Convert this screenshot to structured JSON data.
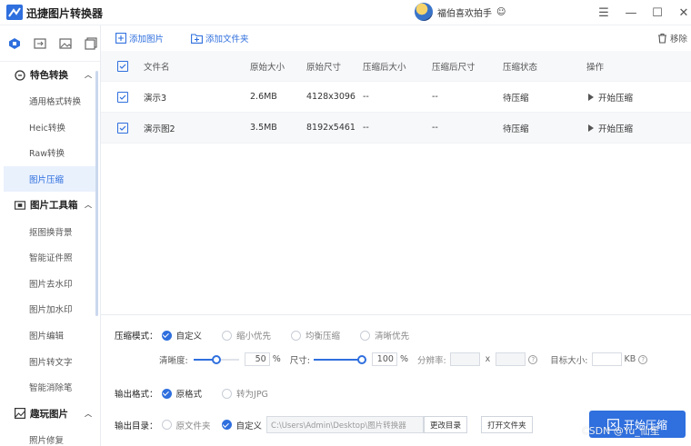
{
  "app": {
    "title": "迅捷图片转换器",
    "user_name": "福伯喜欢拍手"
  },
  "window": {
    "minimize": "—",
    "maximize": "☐",
    "close": "✕",
    "menu": "☰"
  },
  "sidebar": {
    "groups": [
      {
        "label": "特色转换",
        "items": [
          "通用格式转换",
          "Heic转换",
          "Raw转换",
          "图片压缩"
        ]
      },
      {
        "label": "图片工具箱",
        "items": [
          "抠图换背景",
          "智能证件照",
          "图片去水印",
          "图片加水印",
          "图片编辑",
          "图片转文字",
          "智能消除笔"
        ]
      },
      {
        "label": "趣玩图片",
        "items": [
          "照片修复"
        ]
      }
    ],
    "active_item": "图片压缩"
  },
  "toolbar": {
    "add_image": "添加图片",
    "add_folder": "添加文件夹",
    "remove": "移除"
  },
  "table": {
    "headers": [
      "文件名",
      "原始大小",
      "原始尺寸",
      "压缩后大小",
      "压缩后尺寸",
      "压缩状态",
      "操作"
    ],
    "rows": [
      {
        "name": "演示3",
        "size": "2.6MB",
        "dims": "4128x3096",
        "after_size": "--",
        "after_dims": "--",
        "status": "待压缩",
        "action": "开始压缩"
      },
      {
        "name": "演示图2",
        "size": "3.5MB",
        "dims": "8192x5461",
        "after_size": "--",
        "after_dims": "--",
        "status": "待压缩",
        "action": "开始压缩"
      }
    ]
  },
  "settings": {
    "mode_label": "压缩模式：",
    "modes": [
      "自定义",
      "缩小优先",
      "均衡压缩",
      "清晰优先"
    ],
    "clarity_label": "清晰度:",
    "clarity_value": "50",
    "clarity_fraction": 0.5,
    "percent": "%",
    "size_label": "尺寸:",
    "size_value": "100",
    "size_fraction": 1.0,
    "resolution_label": "分辨率:",
    "x_sep": "x",
    "target_label": "目标大小:",
    "kb": "KB",
    "qmark": "?",
    "format_label": "输出格式：",
    "formats": [
      "原格式",
      "转为JPG"
    ],
    "dir_label": "输出目录：",
    "dirs": [
      "原文件夹",
      "自定义"
    ],
    "path": "C:\\Users\\Admin\\Desktop\\图片转换器",
    "change_dir": "更改目录",
    "open_folder": "打开文件夹",
    "start": "开始压缩"
  },
  "watermark": "CSDN @Yu_仙笙",
  "colors": {
    "accent": "#2f6fde",
    "active_bg": "#e9f1fd"
  }
}
